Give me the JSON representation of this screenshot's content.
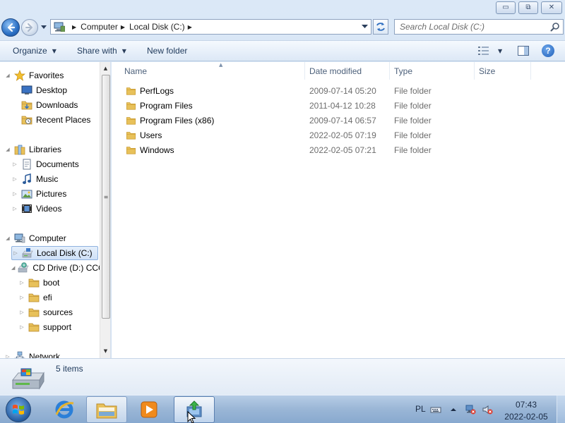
{
  "window": {
    "controls": {
      "minimize": "▭",
      "maximize": "⧉",
      "close": "✕"
    }
  },
  "address": {
    "breadcrumbs": [
      "Computer",
      "Local Disk (C:)"
    ],
    "search_placeholder": "Search Local Disk (C:)"
  },
  "commandbar": {
    "organize": "Organize",
    "share_with": "Share with",
    "new_folder": "New folder",
    "help": "?"
  },
  "navpane": {
    "items": [
      {
        "label": "Favorites",
        "icon": "star-icon",
        "level": 0,
        "expander": "◢"
      },
      {
        "label": "Desktop",
        "icon": "desktop-icon",
        "level": 1
      },
      {
        "label": "Downloads",
        "icon": "downloads-folder-icon",
        "level": 1
      },
      {
        "label": "Recent Places",
        "icon": "recent-places-icon",
        "level": 1
      },
      {
        "label": "Libraries",
        "icon": "libraries-icon",
        "level": 0,
        "expander": "◢"
      },
      {
        "label": "Documents",
        "icon": "documents-icon",
        "level": 1,
        "expander": "▷"
      },
      {
        "label": "Music",
        "icon": "music-icon",
        "level": 1,
        "expander": "▷"
      },
      {
        "label": "Pictures",
        "icon": "pictures-icon",
        "level": 1,
        "expander": "▷"
      },
      {
        "label": "Videos",
        "icon": "videos-icon",
        "level": 1,
        "expander": "▷"
      },
      {
        "label": "Computer",
        "icon": "computer-icon",
        "level": 0,
        "expander": "◢"
      },
      {
        "label": "Local Disk (C:)",
        "icon": "hard-drive-icon",
        "level": 1,
        "expander": "▷",
        "selected": true
      },
      {
        "label": "CD Drive (D:) CCC",
        "icon": "cd-drive-icon",
        "level": 1,
        "expander": "◢"
      },
      {
        "label": "boot",
        "icon": "folder-icon",
        "level": 2,
        "expander": "▷"
      },
      {
        "label": "efi",
        "icon": "folder-icon",
        "level": 2,
        "expander": "▷"
      },
      {
        "label": "sources",
        "icon": "folder-icon",
        "level": 2,
        "expander": "▷"
      },
      {
        "label": "support",
        "icon": "folder-icon",
        "level": 2,
        "expander": "▷"
      },
      {
        "label": "Network",
        "icon": "network-icon",
        "level": 0,
        "expander": "▷"
      }
    ]
  },
  "filelist": {
    "columns": [
      "Name",
      "Date modified",
      "Type",
      "Size"
    ],
    "rows": [
      {
        "name": "PerfLogs",
        "date": "2009-07-14 05:20",
        "type": "File folder",
        "size": ""
      },
      {
        "name": "Program Files",
        "date": "2011-04-12 10:28",
        "type": "File folder",
        "size": ""
      },
      {
        "name": "Program Files (x86)",
        "date": "2009-07-14 06:57",
        "type": "File folder",
        "size": ""
      },
      {
        "name": "Users",
        "date": "2022-02-05 07:19",
        "type": "File folder",
        "size": ""
      },
      {
        "name": "Windows",
        "date": "2022-02-05 07:21",
        "type": "File folder",
        "size": ""
      }
    ]
  },
  "details": {
    "item_count": "5 items"
  },
  "taskbar": {
    "apps": [
      "internet-explorer-icon",
      "windows-explorer-icon",
      "media-player-icon",
      "setup-icon"
    ],
    "language": "PL",
    "time": "07:43",
    "date": "2022-02-05"
  },
  "colors": {
    "folder": "#e8c15a",
    "folder_dark": "#c99a2e",
    "accent": "#1e395b",
    "selection": "#cfe1f7"
  }
}
